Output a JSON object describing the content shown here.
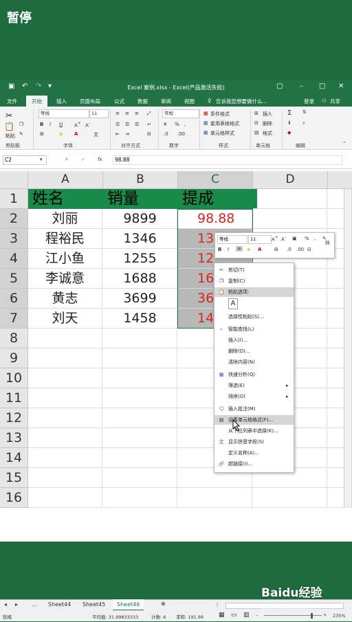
{
  "overlay": {
    "pause_label": "暂停"
  },
  "window": {
    "title": "Excel 案例.xlsx - Excel(产品激活失败)",
    "tabs": [
      "文件",
      "开始",
      "插入",
      "页面布局",
      "公式",
      "数据",
      "审阅",
      "视图"
    ],
    "tell_me": "告诉我您想要做什么...",
    "login": "登录",
    "share": "共享"
  },
  "ribbon": {
    "paste": "粘贴",
    "font_name": "等线",
    "font_size": "11",
    "number_format": "常规",
    "cond_format": "条件格式",
    "table_format": "套用表格格式",
    "cell_style": "单元格样式",
    "insert": "插入",
    "delete": "删除",
    "format": "格式",
    "groups": [
      "剪贴板",
      "字体",
      "对齐方式",
      "数字",
      "样式",
      "单元格",
      "编辑"
    ]
  },
  "formula_bar": {
    "name_box": "C2",
    "fx": "fx",
    "value": "98.88"
  },
  "sheet": {
    "columns": [
      "A",
      "B",
      "C",
      "D"
    ],
    "rows": [
      "1",
      "2",
      "3",
      "4",
      "5",
      "6",
      "7",
      "8",
      "9",
      "10",
      "11",
      "12",
      "13",
      "14",
      "15",
      "16"
    ],
    "header": [
      "姓名",
      "销量",
      "提成"
    ],
    "names": [
      "刘丽",
      "程裕民",
      "江小鱼",
      "李诚意",
      "黄志",
      "刘天"
    ],
    "sales": [
      "9899",
      "1346",
      "1255",
      "1688",
      "3699",
      "1458"
    ],
    "commission_visible": [
      "98.88",
      "13",
      "12",
      "16",
      "36",
      "14"
    ]
  },
  "mini_toolbar": {
    "font": "等线",
    "size": "11",
    "percent": "%"
  },
  "context_menu": {
    "items": [
      "剪切(T)",
      "复制(C)",
      "粘贴选项:",
      "选择性粘贴(S)...",
      "智能查找(L)",
      "插入(I)...",
      "删除(D)...",
      "清除内容(N)",
      "快速分析(Q)",
      "筛选(E)",
      "排序(O)",
      "插入批注(M)",
      "设置单元格格式(F)...",
      "从下拉列表中选择(K)...",
      "显示拼音字段(S)",
      "定义名称(A)...",
      "超链接(I)..."
    ]
  },
  "sheet_tabs": {
    "ellipsis": "...",
    "tabs": [
      "Sheet44",
      "Sheet45",
      "Sheet46"
    ],
    "active": "Sheet46"
  },
  "status": {
    "ready": "就绪",
    "average": "平均值: 31.99833333",
    "count": "计数: 6",
    "sum": "求和: 191.99",
    "zoom": "235%"
  },
  "watermark": {
    "brand": "Baidu经验",
    "url": "jingyan.baidu.com"
  },
  "colors": {
    "excel_green": "#217346",
    "header_fill": "#1a8a4a",
    "background": "#1e6b3d",
    "red_text": "#d9251c"
  }
}
